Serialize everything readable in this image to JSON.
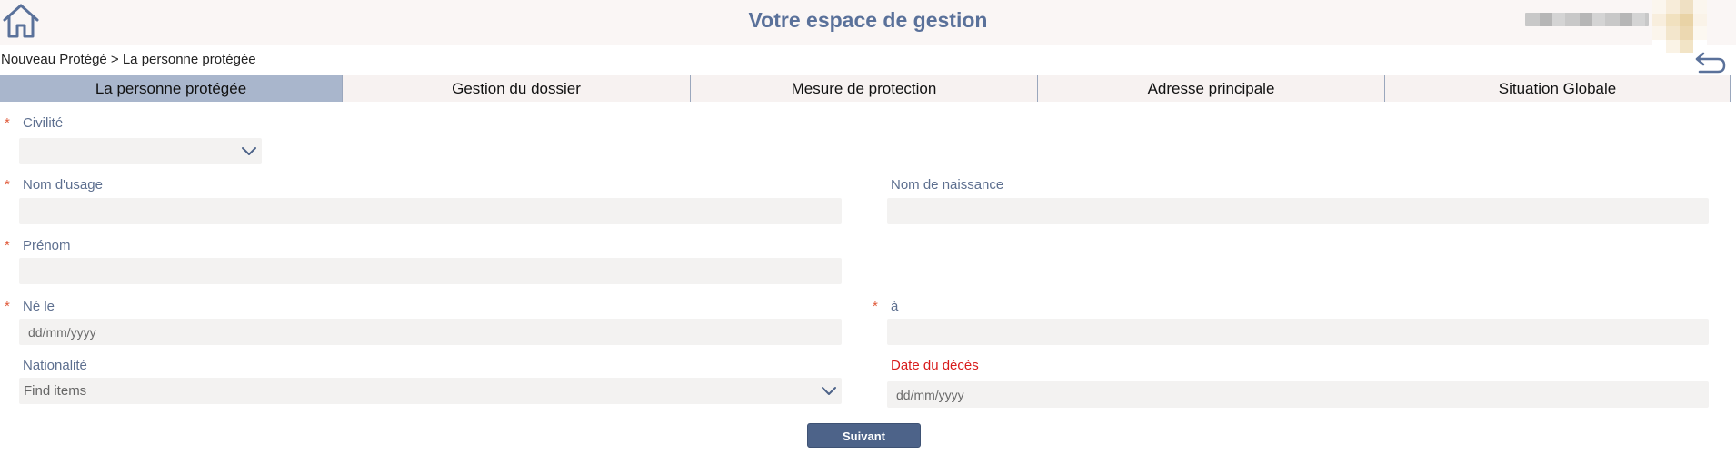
{
  "header": {
    "title": "Votre espace de gestion"
  },
  "breadcrumb": "Nouveau Protégé > La personne protégée",
  "tabs": [
    {
      "label": "La personne protégée",
      "active": true
    },
    {
      "label": "Gestion du dossier",
      "active": false
    },
    {
      "label": "Mesure de protection",
      "active": false
    },
    {
      "label": "Adresse principale",
      "active": false
    },
    {
      "label": "Situation Globale",
      "active": false
    }
  ],
  "form": {
    "required_mark": "*",
    "civilite": {
      "label": "Civilité",
      "value": ""
    },
    "nom_usage": {
      "label": "Nom d'usage",
      "value": ""
    },
    "nom_naissance": {
      "label": "Nom de naissance",
      "value": ""
    },
    "prenom": {
      "label": "Prénom",
      "value": ""
    },
    "ne_le": {
      "label": "Né le",
      "placeholder": "dd/mm/yyyy"
    },
    "lieu": {
      "label": "à",
      "value": ""
    },
    "nationalite": {
      "label": "Nationalité",
      "placeholder": "Find items"
    },
    "date_deces": {
      "label": "Date du décès",
      "placeholder": "dd/mm/yyyy"
    }
  },
  "actions": {
    "next_label": "Suivant"
  },
  "icons": {
    "home": "home-icon",
    "back": "undo-arrow-icon",
    "chevron": "chevron-down-icon"
  },
  "colors": {
    "accent": "#5a719a",
    "active_tab": "#a9b6cc",
    "button": "#4d6389",
    "required": "#e05a3a",
    "error_label": "#d81b1b"
  }
}
